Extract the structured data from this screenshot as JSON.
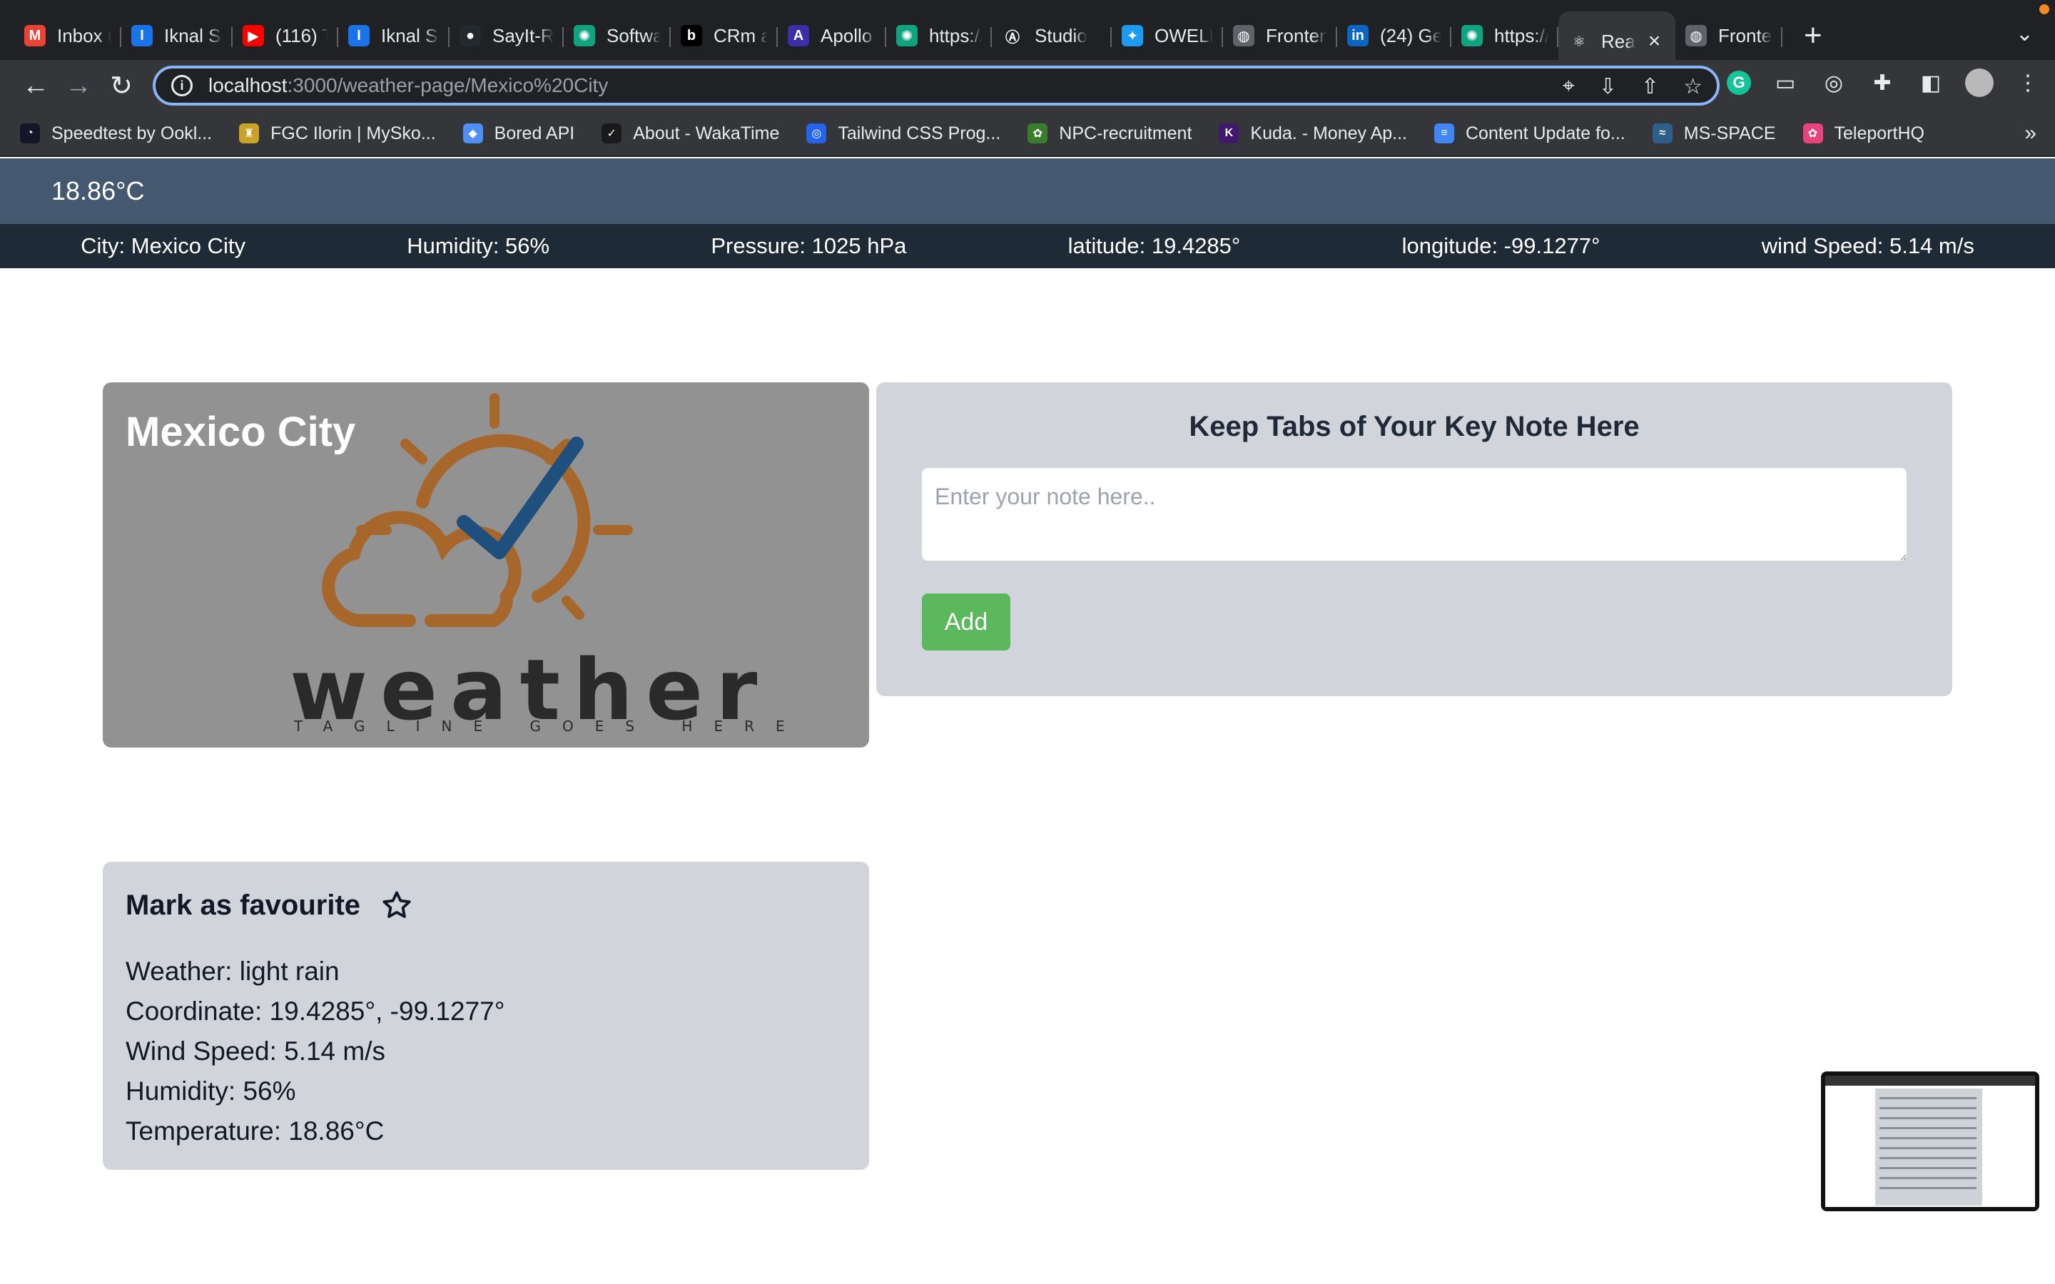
{
  "browser": {
    "tabs": [
      {
        "title": "Inbox (",
        "icon": "gmail-icon",
        "color": "#ea4335",
        "glyph": "M"
      },
      {
        "title": "Iknal Se",
        "icon": "app-icon",
        "color": "#1a73e8",
        "glyph": "I"
      },
      {
        "title": "(116) Th",
        "icon": "youtube-icon",
        "color": "#ff0000",
        "glyph": "▶"
      },
      {
        "title": "Iknal Se",
        "icon": "app-icon",
        "color": "#1a73e8",
        "glyph": "I"
      },
      {
        "title": "SayIt-R",
        "icon": "github-icon",
        "color": "#24292e",
        "glyph": "●"
      },
      {
        "title": "Softwar",
        "icon": "chatgpt-icon",
        "color": "#10a37f",
        "glyph": "✺"
      },
      {
        "title": "CRm ap",
        "icon": "b-icon",
        "color": "#000000",
        "glyph": "b"
      },
      {
        "title": "Apollo :",
        "icon": "apollo-icon",
        "color": "#3b2ea8",
        "glyph": "A"
      },
      {
        "title": "https://",
        "icon": "chatgpt-icon",
        "color": "#10a37f",
        "glyph": "✺"
      },
      {
        "title": "Studio",
        "icon": "apollo-studio-icon",
        "color": "#202124",
        "glyph": "Ⓐ"
      },
      {
        "title": "OWELL",
        "icon": "twitter-icon",
        "color": "#1d9bf0",
        "glyph": "✦"
      },
      {
        "title": "Fronten",
        "icon": "globe-icon",
        "color": "#5f6368",
        "glyph": "◍"
      },
      {
        "title": "(24) Ge",
        "icon": "linkedin-icon",
        "color": "#0a66c2",
        "glyph": "in"
      },
      {
        "title": "https://",
        "icon": "chatgpt-icon",
        "color": "#10a37f",
        "glyph": "✺"
      },
      {
        "title": "Rea",
        "icon": "react-icon",
        "color": "#35363a",
        "glyph": "⚛",
        "active": true
      },
      {
        "title": "Fronten",
        "icon": "globe-icon",
        "color": "#5f6368",
        "glyph": "◍"
      }
    ],
    "url_host": "localhost",
    "url_path": ":3000/weather-page/Mexico%20City",
    "bookmarks": [
      {
        "label": "Speedtest by Ookl...",
        "color": "#141526",
        "glyph": "◔"
      },
      {
        "label": "FGC Ilorin | MySko...",
        "color": "#c9a227",
        "glyph": "♜"
      },
      {
        "label": "Bored API",
        "color": "#4f8ff7",
        "glyph": "◆"
      },
      {
        "label": "About - WakaTime",
        "color": "#1a1a1a",
        "glyph": "✓"
      },
      {
        "label": "Tailwind CSS Prog...",
        "color": "#2563eb",
        "glyph": "◎"
      },
      {
        "label": "NPC-recruitment",
        "color": "#3a7d2c",
        "glyph": "✿"
      },
      {
        "label": "Kuda. - Money Ap...",
        "color": "#40196d",
        "glyph": "K"
      },
      {
        "label": "Content Update fo...",
        "color": "#4285f4",
        "glyph": "≡"
      },
      {
        "label": "MS-SPACE",
        "color": "#2d5f8a",
        "glyph": "≈"
      },
      {
        "label": "TeleportHQ",
        "color": "#e8437a",
        "glyph": "✿"
      }
    ]
  },
  "page": {
    "header_temp": "18.86°C",
    "info": {
      "city": "City: Mexico City",
      "humidity": "Humidity: 56%",
      "pressure": "Pressure: 1025 hPa",
      "latitude": "latitude: 19.4285°",
      "longitude": "longitude: -99.1277°",
      "wind": "wind Speed: 5.14 m/s"
    },
    "hero": {
      "city": "Mexico City",
      "logo_word": "weather",
      "logo_tagline": "TAGLINE GOES HERE"
    },
    "note": {
      "heading": "Keep Tabs of Your Key Note Here",
      "placeholder": "Enter your note here..",
      "value": "",
      "add_label": "Add"
    },
    "favourite": {
      "title": "Mark as favourite",
      "weather": "Weather: light rain",
      "coordinate": "Coordinate: 19.4285°, -99.1277°",
      "wind": "Wind Speed: 5.14 m/s",
      "humidity": "Humidity: 56%",
      "temperature": "Temperature: 18.86°C"
    }
  },
  "colors": {
    "topbar": "#44586f",
    "infobar": "#1e2a36",
    "hero_bg": "#929292",
    "card_bg": "#d1d5db",
    "add_button": "#5cb85c",
    "logo_orange": "#a8672a",
    "logo_blue": "#1e4f7d"
  }
}
